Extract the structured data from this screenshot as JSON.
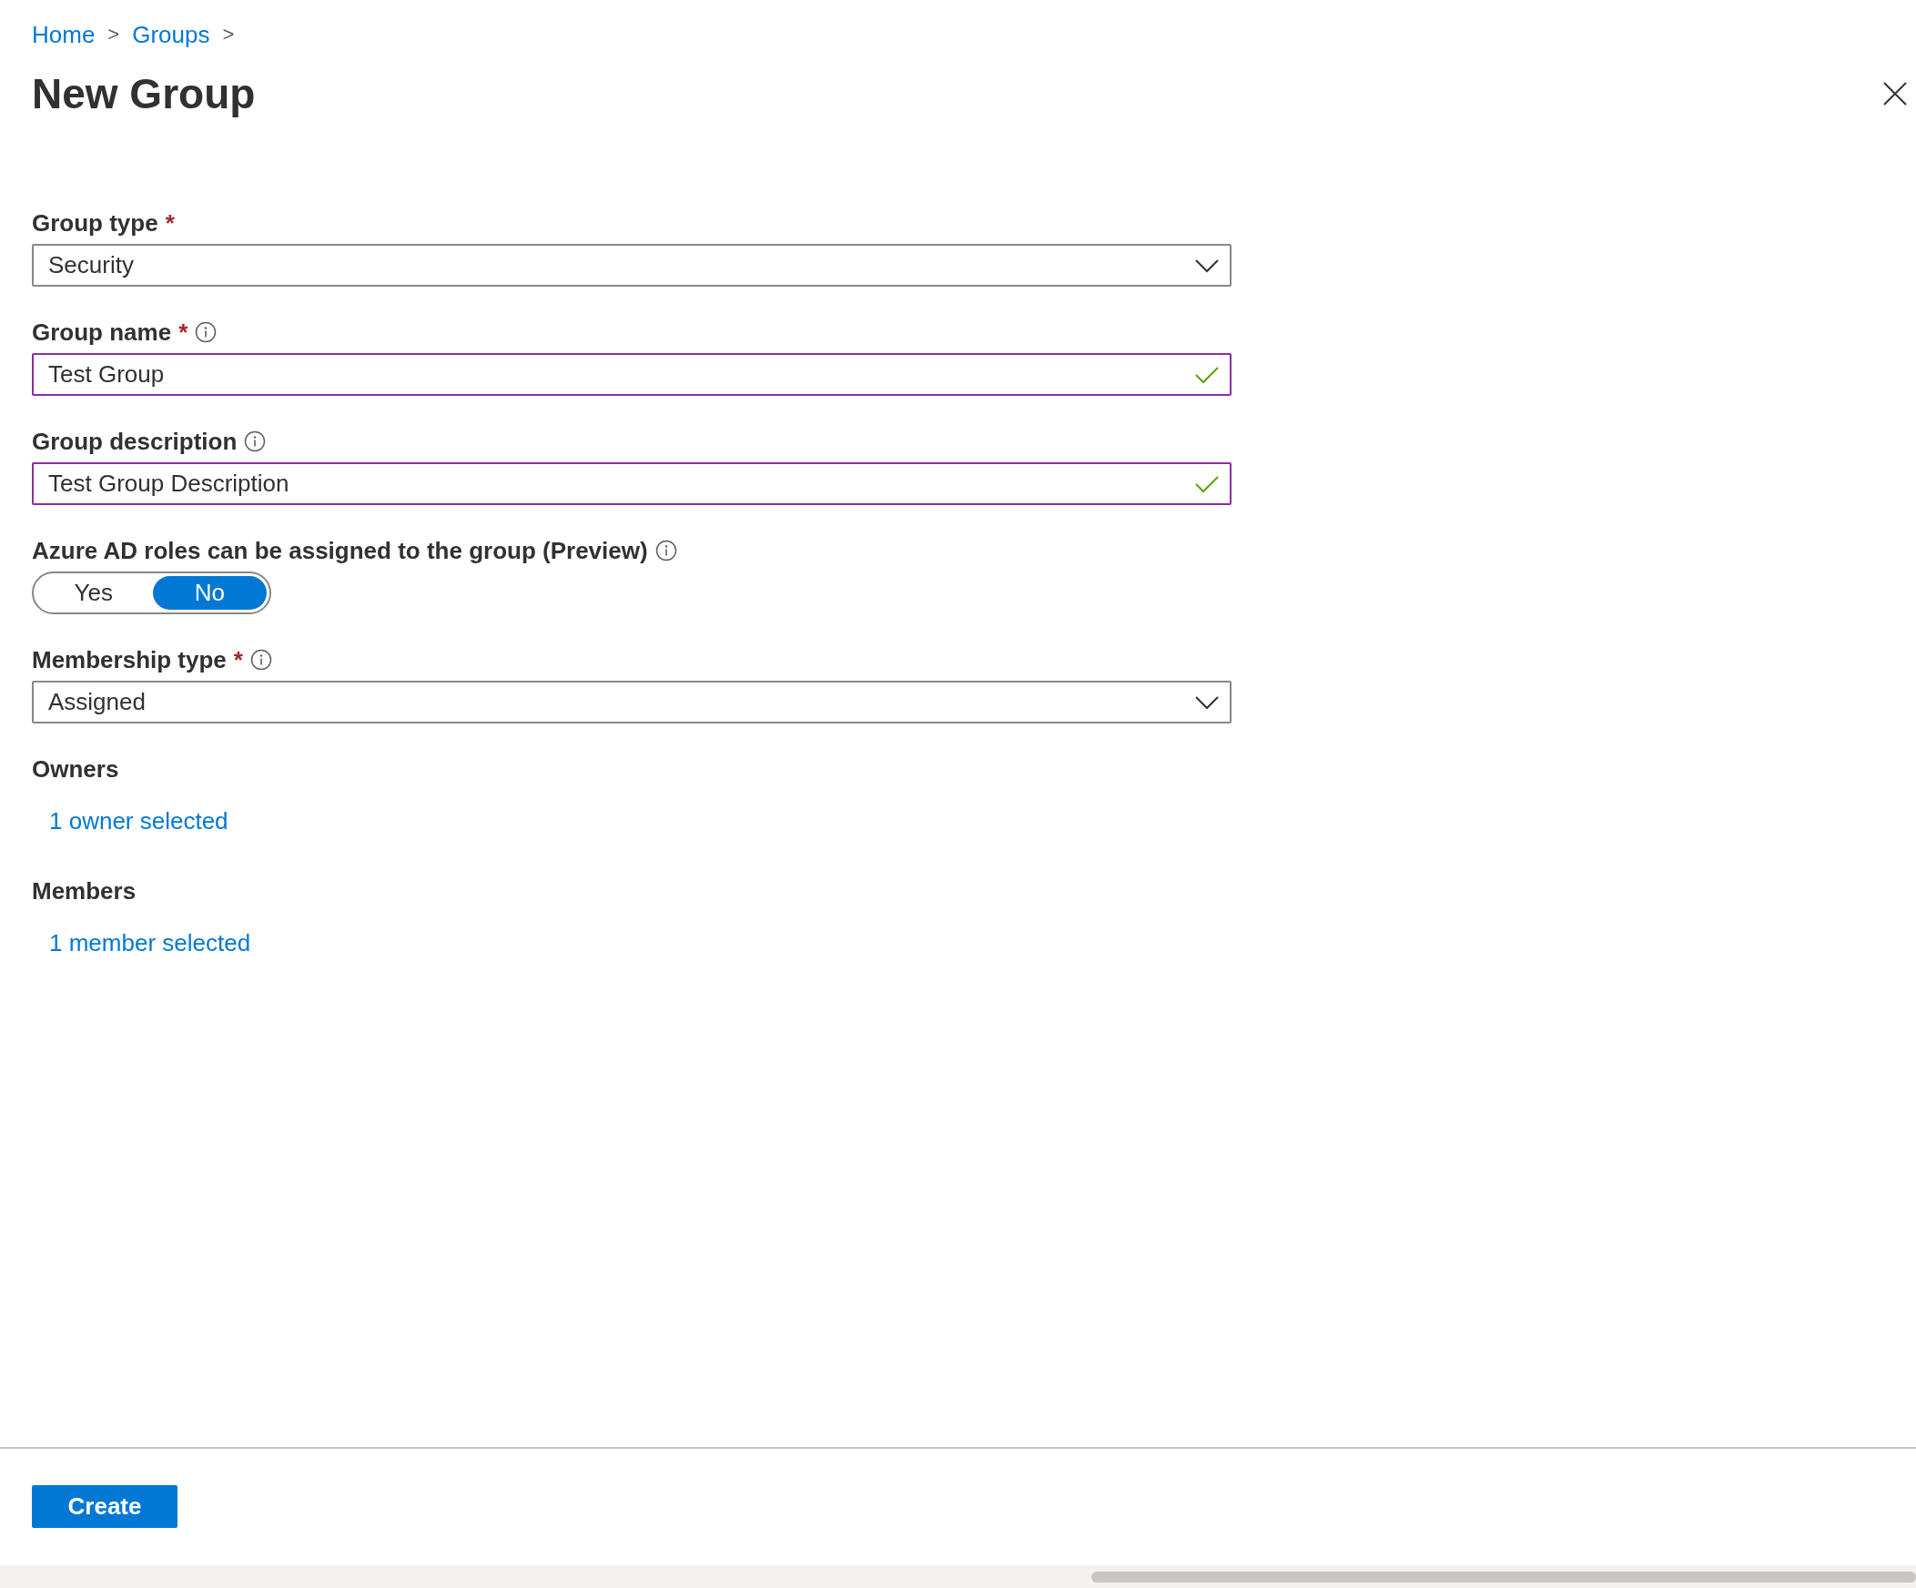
{
  "breadcrumb": [
    {
      "label": "Home",
      "separator": ">"
    },
    {
      "label": "Groups",
      "separator": ">"
    }
  ],
  "title": "New Group",
  "fields": [
    {
      "kind": "dropdown",
      "label": "Group type",
      "required_mark": "*",
      "info": false,
      "value": "Security"
    },
    {
      "kind": "text",
      "label": "Group name",
      "required_mark": "*",
      "info": true,
      "value": "Test Group",
      "valid": true
    },
    {
      "kind": "text",
      "label": "Group description",
      "info": true,
      "value": "Test Group Description",
      "valid": true
    },
    {
      "kind": "toggle",
      "label": "Azure AD roles can be assigned to the group (Preview)",
      "info": true,
      "options": [
        {
          "label": "Yes",
          "selected": false
        },
        {
          "label": "No",
          "selected": true
        }
      ]
    },
    {
      "kind": "dropdown",
      "label": "Membership type",
      "required_mark": "*",
      "info": true,
      "value": "Assigned"
    },
    {
      "kind": "link",
      "label": "Owners",
      "info": false,
      "value": "1 owner selected"
    },
    {
      "kind": "link",
      "label": "Members",
      "info": false,
      "value": "1 member selected"
    }
  ],
  "create_button": "Create"
}
